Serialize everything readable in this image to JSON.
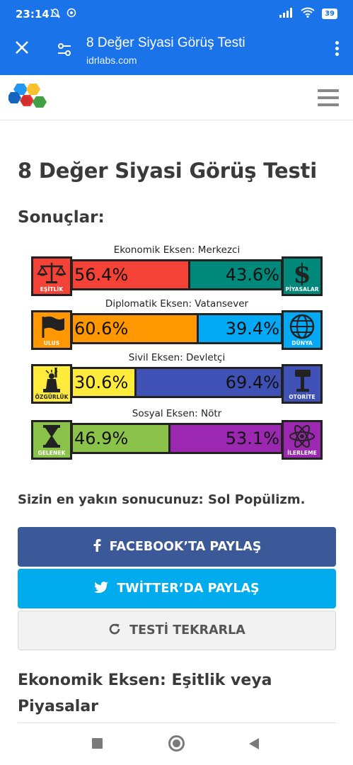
{
  "status": {
    "time": "23:14",
    "battery": "39"
  },
  "browser": {
    "title": "8 Değer Siyasi Görüş Testi",
    "url": "idrlabs.com"
  },
  "page": {
    "title": "8 Değer Siyasi Görüş Testi",
    "results_heading": "Sonuçlar:",
    "closest": "Sizin en yakın sonucunuz: Sol Popülizm.",
    "section_title": "Ekonomik Eksen: Eşitlik veya Piyasalar"
  },
  "axes": [
    {
      "caption": "Ekonomik Eksen: Merkezci",
      "left_label": "EŞİTLİK",
      "right_label": "PİYASALAR",
      "left_value": "56.4%",
      "right_value": "43.6%",
      "left_share": 0.564,
      "left_color": "#f44336",
      "right_color": "#00897b",
      "left_icon": "scales-icon",
      "right_icon": "dollar-icon"
    },
    {
      "caption": "Diplomatik Eksen: Vatansever",
      "left_label": "ULUS",
      "right_label": "DÜNYA",
      "left_value": "60.6%",
      "right_value": "39.4%",
      "left_share": 0.606,
      "left_color": "#ff9800",
      "right_color": "#03a9f4",
      "left_icon": "flag-icon",
      "right_icon": "globe-icon"
    },
    {
      "caption": "Sivil Eksen: Devletçi",
      "left_label": "ÖZGÜRLÜK",
      "right_label": "OTORİTE",
      "left_value": "30.6%",
      "right_value": "69.4%",
      "left_share": 0.306,
      "left_color": "#ffeb3b",
      "right_color": "#3f51b5",
      "left_icon": "liberty-statue-icon",
      "right_icon": "gavel-icon"
    },
    {
      "caption": "Sosyal Eksen: Nötr",
      "left_label": "GELENEK",
      "right_label": "İLERLEME",
      "left_value": "46.9%",
      "right_value": "53.1%",
      "left_share": 0.469,
      "left_color": "#8bc34a",
      "right_color": "#9c27b0",
      "left_icon": "hourglass-icon",
      "right_icon": "atom-icon"
    }
  ],
  "buttons": {
    "facebook": "FACEBOOK’TA PAYLAŞ",
    "twitter": "TWİTTER’DA PAYLAŞ",
    "retry": "TESTİ TEKRARLA"
  }
}
